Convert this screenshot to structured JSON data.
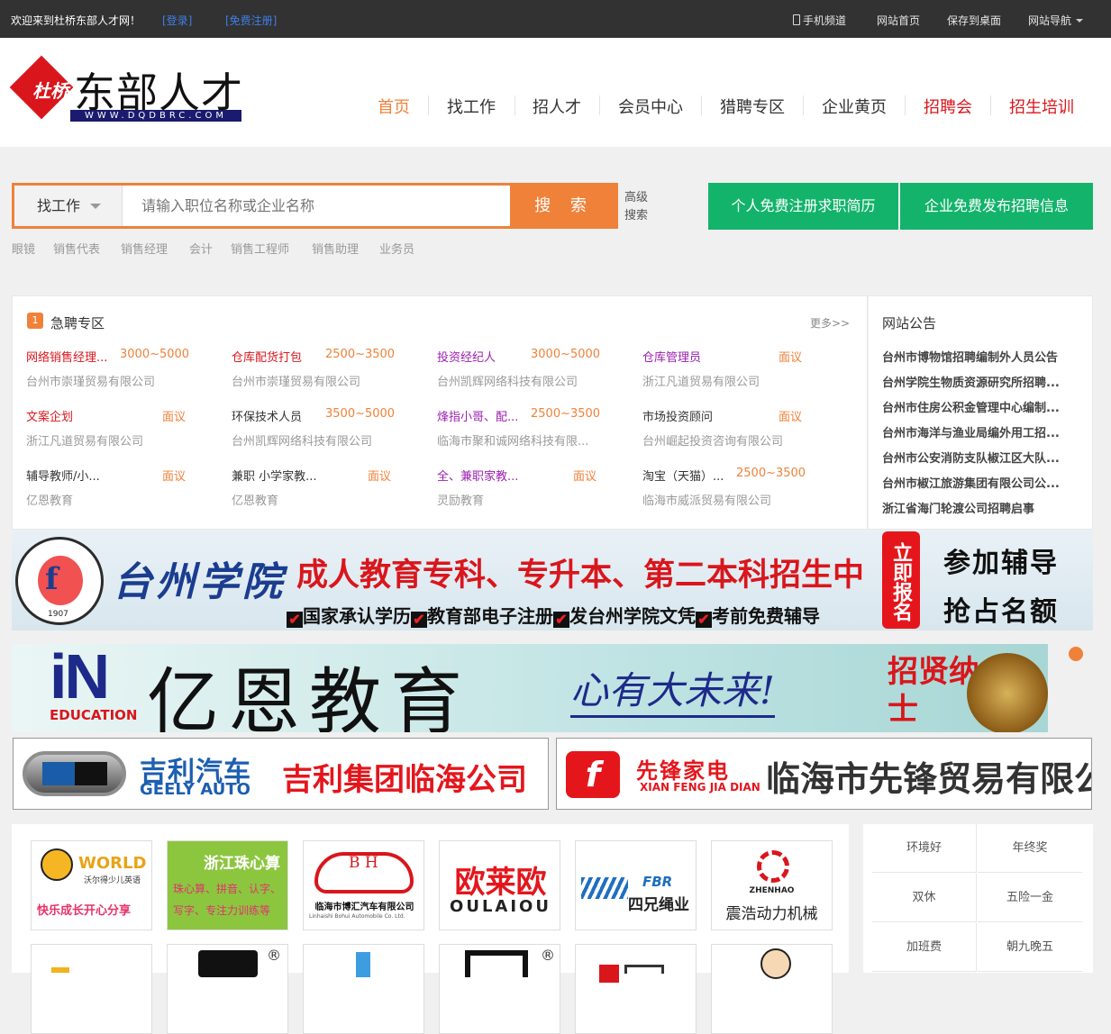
{
  "topbar": {
    "welcome": "欢迎来到杜桥东部人才网！",
    "login": "[登录]",
    "register": "[免费注册]",
    "mobile": "手机频道",
    "home": "网站首页",
    "save": "保存到桌面",
    "sitenav": "网站导航"
  },
  "logo": {
    "small": "杜桥",
    "big": "东部人才",
    "url": "WWW.DQDBRC.COM"
  },
  "nav": [
    "首页",
    "找工作",
    "招人才",
    "会员中心",
    "猎聘专区",
    "企业黄页",
    "招聘会",
    "招生培训"
  ],
  "colors": {
    "accent": "#f08139",
    "green": "#13b36b",
    "red": "#d9161c",
    "active": "#f08139"
  },
  "search": {
    "type": "找工作",
    "placeholder": "请输入职位名称或企业名称",
    "button": "搜 索",
    "advanced": "高级搜索",
    "personal": "个人免费注册求职简历",
    "company": "企业免费发布招聘信息"
  },
  "hot": [
    "眼镜",
    "销售代表",
    "销售经理",
    "会计",
    "销售工程师",
    "销售助理",
    "业务员"
  ],
  "urgent": {
    "title": "急聘专区",
    "more": "更多>>",
    "jobs": [
      {
        "title": "网络销售经理...",
        "salary": "3000~5000",
        "company": "台州市崇瑾贸易有限公司",
        "color": "#d9161c"
      },
      {
        "title": "仓库配货打包",
        "salary": "2500~3500",
        "company": "台州市崇瑾贸易有限公司",
        "color": "#d9161c"
      },
      {
        "title": "投资经纪人",
        "salary": "3000~5000",
        "company": "台州凯辉网络科技有限公司",
        "color": "#9b1fb0"
      },
      {
        "title": "仓库管理员",
        "salary": "面议",
        "company": "浙江凡道贸易有限公司",
        "color": "#9b1fb0"
      },
      {
        "title": "文案企划",
        "salary": "面议",
        "company": "浙江凡道贸易有限公司",
        "color": "#d9161c"
      },
      {
        "title": "环保技术人员",
        "salary": "3500~5000",
        "company": "台州凯辉网络科技有限公司",
        "color": "#333333"
      },
      {
        "title": "烽指小哥、配...",
        "salary": "2500~3500",
        "company": "临海市聚和诚网络科技有限...",
        "color": "#9b1fb0"
      },
      {
        "title": "市场投资顾问",
        "salary": "面议",
        "company": "台州崛起投资咨询有限公司",
        "color": "#333333"
      },
      {
        "title": "辅导教师/小...",
        "salary": "面议",
        "company": "亿恩教育",
        "color": "#333333"
      },
      {
        "title": "兼职 小学家教...",
        "salary": "面议",
        "company": "亿恩教育",
        "color": "#333333"
      },
      {
        "title": "全、兼职家教...",
        "salary": "面议",
        "company": "灵励教育",
        "color": "#9b1fb0"
      },
      {
        "title": "淘宝（天猫）...",
        "salary": "2500~3500",
        "company": "临海市威派贸易有限公司",
        "color": "#333333"
      }
    ]
  },
  "announce": {
    "title": "网站公告",
    "items": [
      "台州市博物馆招聘编制外人员公告",
      "台州学院生物质资源研究所招聘...",
      "台州市住房公积金管理中心编制...",
      "台州市海洋与渔业局编外用工招...",
      "台州市公安消防支队椒江区大队...",
      "台州市椒江旅游集团有限公司公...",
      "浙江省海门轮渡公司招聘启事"
    ]
  },
  "banners": {
    "taizhou": {
      "name": "台州学院",
      "main": "成人教育专科、专升本、第二本科招生中",
      "sub": [
        "国家承认学历",
        "教育部电子注册",
        "发台州学院文凭",
        "考前免费辅导"
      ],
      "badge": "立即报名",
      "cta1": "参加辅导",
      "cta2": "抢占名额",
      "seal_year": "1907"
    },
    "yien": {
      "in": "iN",
      "edu": "EDUCATION",
      "name": "亿恩教育",
      "slogan": "心有大未来!",
      "tag": "招贤纳士"
    },
    "geely": {
      "brand": "吉利汽车",
      "en": "GEELY AUTO",
      "company": "吉利集团临海公司"
    },
    "xianfeng": {
      "brand": "先锋家电",
      "en": "XIAN FENG JIA DIAN",
      "company": "临海市先锋贸易有限公司"
    }
  },
  "logos": [
    {
      "line1": "WORLD",
      "line2": "沃尔得少儿英语",
      "line3": "快乐成长开心分享"
    },
    {
      "line1": "浙江珠心算",
      "line2": "珠心算、拼音、认字、",
      "line3": "写字、专注力训练等"
    },
    {
      "line1": "B H",
      "line2": "临海市博汇汽车有限公司",
      "line3": "Linhaishi Bohui Automobile Co. Ltd."
    },
    {
      "line1": "欧莱欧",
      "line2": "OULAIOU",
      "line3": ""
    },
    {
      "line1": "FBR",
      "line2": "四兄绳业",
      "line3": ""
    },
    {
      "line1": "ZHENHAO",
      "line2": "震浩动力机械",
      "line3": ""
    }
  ],
  "tags": [
    "环境好",
    "年终奖",
    "双休",
    "五险一金",
    "加班费",
    "朝九晚五"
  ]
}
